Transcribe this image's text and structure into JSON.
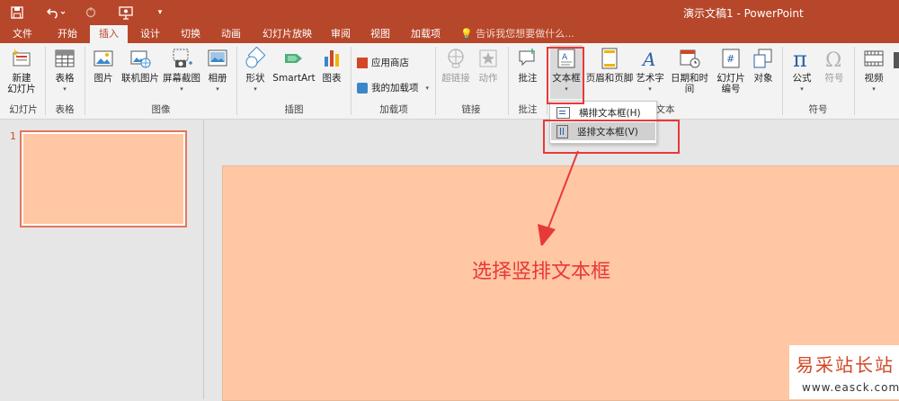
{
  "quick_access": {
    "save_icon": "save-icon",
    "undo_icon": "undo-icon",
    "redo_icon": "redo-icon",
    "present_icon": "present-icon",
    "customize_icon": "customize-icon"
  },
  "window": {
    "title": "演示文稿1 - PowerPoint"
  },
  "tabs": [
    "文件",
    "开始",
    "插入",
    "设计",
    "切换",
    "动画",
    "幻灯片放映",
    "审阅",
    "视图",
    "加载项"
  ],
  "active_tab": "插入",
  "tell_me": "告诉我您想要做什么...",
  "ribbon": {
    "new_slide": "新建\n幻灯片",
    "table": "表格",
    "picture": "图片",
    "online_picture": "联机图片",
    "screenshot": "屏幕截图",
    "album": "相册",
    "shapes": "形状",
    "smartart": "SmartArt",
    "chart": "图表",
    "store": "应用商店",
    "my_addins": "我的加载项",
    "hyperlink": "超链接",
    "action": "动作",
    "comment": "批注",
    "textbox": "文本框",
    "header_footer": "页眉和页脚",
    "wordart": "艺术字",
    "datetime": "日期和时间",
    "slide_number": "幻灯片\n编号",
    "object": "对象",
    "equation": "公式",
    "symbol": "符号",
    "video": "视频",
    "groups": {
      "slides": "幻灯片",
      "tables": "表格",
      "images": "图像",
      "illustrations": "插图",
      "addins": "加载项",
      "links": "链接",
      "comments": "批注",
      "text": "文本",
      "symbols": "符号"
    }
  },
  "textbox_menu": {
    "horizontal": "横排文本框(H)",
    "vertical": "竖排文本框(V)"
  },
  "slide_panel": {
    "slide_number": "1"
  },
  "annotation": "选择竖排文本框",
  "watermark": {
    "main": "易采站长站",
    "url": "www.easck.com"
  },
  "colors": {
    "accent": "#b7472a",
    "slide": "#ffc7a3",
    "highlight": "#e8393a"
  }
}
